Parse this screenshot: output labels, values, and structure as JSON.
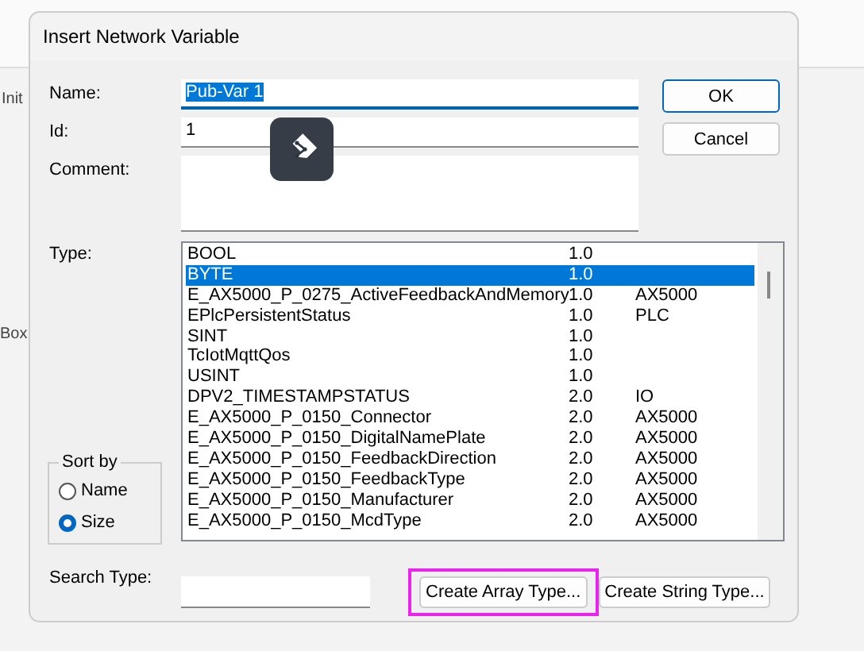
{
  "background": {
    "labels": [
      "Init",
      "Box"
    ]
  },
  "dialog": {
    "title": "Insert Network Variable",
    "name": {
      "label": "Name:",
      "value": "Pub-Var 1",
      "selected": true
    },
    "id": {
      "label": "Id:",
      "value": "1"
    },
    "comment": {
      "label": "Comment:"
    },
    "type": {
      "label": "Type:",
      "rows": [
        {
          "name": "BOOL",
          "size": "1.0",
          "group": "",
          "selected": false
        },
        {
          "name": "BYTE",
          "size": "1.0",
          "group": "",
          "selected": true
        },
        {
          "name": "E_AX5000_P_0275_ActiveFeedbackAndMemory",
          "size": "1.0",
          "group": "AX5000",
          "selected": false
        },
        {
          "name": "EPlcPersistentStatus",
          "size": "1.0",
          "group": "PLC",
          "selected": false
        },
        {
          "name": "SINT",
          "size": "1.0",
          "group": "",
          "selected": false
        },
        {
          "name": "TcIotMqttQos",
          "size": "1.0",
          "group": "",
          "selected": false
        },
        {
          "name": "USINT",
          "size": "1.0",
          "group": "",
          "selected": false
        },
        {
          "name": "DPV2_TIMESTAMPSTATUS",
          "size": "2.0",
          "group": "IO",
          "selected": false
        },
        {
          "name": "E_AX5000_P_0150_Connector",
          "size": "2.0",
          "group": "AX5000",
          "selected": false
        },
        {
          "name": "E_AX5000_P_0150_DigitalNamePlate",
          "size": "2.0",
          "group": "AX5000",
          "selected": false
        },
        {
          "name": "E_AX5000_P_0150_FeedbackDirection",
          "size": "2.0",
          "group": "AX5000",
          "selected": false
        },
        {
          "name": "E_AX5000_P_0150_FeedbackType",
          "size": "2.0",
          "group": "AX5000",
          "selected": false
        },
        {
          "name": "E_AX5000_P_0150_Manufacturer",
          "size": "2.0",
          "group": "AX5000",
          "selected": false
        },
        {
          "name": "E_AX5000_P_0150_McdType",
          "size": "2.0",
          "group": "AX5000",
          "selected": false
        }
      ]
    },
    "sort_by": {
      "label": "Sort by",
      "options": [
        {
          "label": "Name",
          "selected": false
        },
        {
          "label": "Size",
          "selected": true
        }
      ]
    },
    "search": {
      "label": "Search Type:"
    },
    "buttons": [
      {
        "label": "OK",
        "kind": "default"
      },
      {
        "label": "Cancel",
        "kind": "normal"
      }
    ],
    "bottom_buttons": [
      {
        "label": "Create Array Type...",
        "highlighted": true
      },
      {
        "label": "Create String Type...",
        "highlighted": false
      }
    ]
  }
}
